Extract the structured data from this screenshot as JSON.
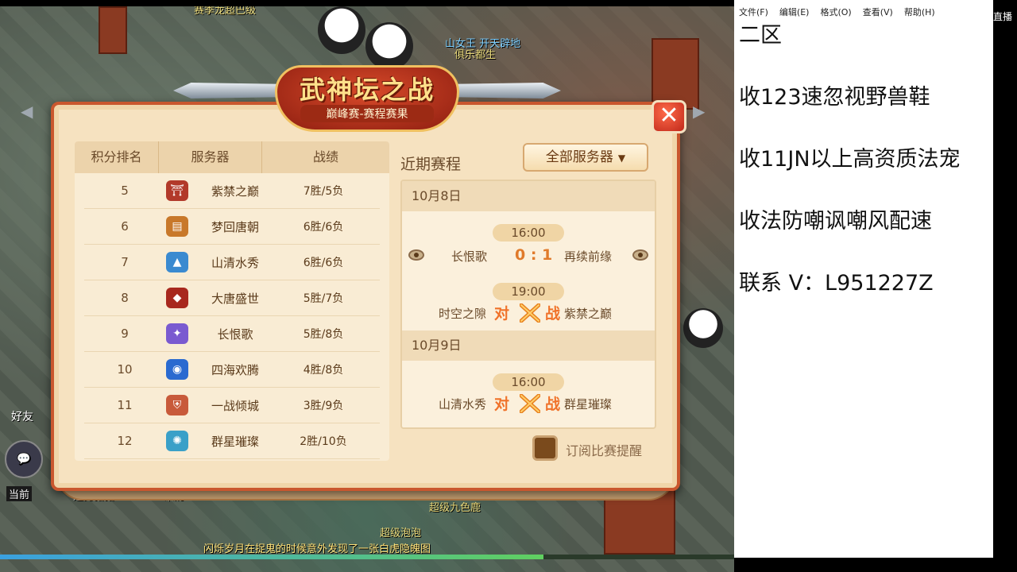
{
  "game": {
    "bg_texts": {
      "top_left": "赛季龙超巴级",
      "guild_line": "山女王  开天辟地",
      "name_tag": "俱乐都生",
      "player_a": "超级九色鹿",
      "player_b": "超级泡泡",
      "friends": "好友",
      "current": "当前",
      "stat_line": "逗男猪猪 69  3456  宋奶"
    },
    "chat_line": "闪烁岁月在捉鬼的时候意外发现了一张白虎隐魄图",
    "progress": 0.74
  },
  "dialog": {
    "title": "武神坛之战",
    "subtitle": "巅峰赛-赛程赛果",
    "close_label": "✕",
    "ranking": {
      "headers": [
        "积分排名",
        "服务器",
        "战绩"
      ],
      "rows": [
        {
          "rank": "5",
          "server": "紫禁之巅",
          "record": "7胜/5负",
          "icon": "palace-icon",
          "color": "#b23a2a"
        },
        {
          "rank": "6",
          "server": "梦回唐朝",
          "record": "6胜/6负",
          "icon": "scroll-icon",
          "color": "#c8782a"
        },
        {
          "rank": "7",
          "server": "山清水秀",
          "record": "6胜/6负",
          "icon": "mountain-icon",
          "color": "#3a8ad0"
        },
        {
          "rank": "8",
          "server": "大唐盛世",
          "record": "5胜/7负",
          "icon": "lantern-icon",
          "color": "#a8281e"
        },
        {
          "rank": "9",
          "server": "长恨歌",
          "record": "5胜/8负",
          "icon": "feather-icon",
          "color": "#7a5ad0"
        },
        {
          "rank": "10",
          "server": "四海欢腾",
          "record": "4胜/8负",
          "icon": "wave-icon",
          "color": "#2a6ad0"
        },
        {
          "rank": "11",
          "server": "一战倾城",
          "record": "3胜/9负",
          "icon": "armor-icon",
          "color": "#c85a3a"
        },
        {
          "rank": "12",
          "server": "群星璀璨",
          "record": "2胜/10负",
          "icon": "star-icon",
          "color": "#3aa0c8"
        }
      ]
    },
    "schedule": {
      "title": "近期赛程",
      "filter_label": "全部服务器",
      "days": [
        {
          "date": "10月8日",
          "matches": [
            {
              "time": "16:00",
              "left": "长恨歌",
              "right": "再续前缘",
              "score": "0 : 1",
              "finished": true
            },
            {
              "time": "19:00",
              "left": "时空之隙",
              "right": "紫禁之巅",
              "dui": "对",
              "zhan": "战",
              "finished": false
            }
          ]
        },
        {
          "date": "10月9日",
          "matches": [
            {
              "time": "16:00",
              "left": "山清水秀",
              "right": "群星璀璨",
              "dui": "对",
              "zhan": "战",
              "finished": false
            }
          ]
        }
      ]
    },
    "subscribe_label": "订阅比赛提醒"
  },
  "notepad": {
    "menu": [
      "文件(F)",
      "编辑(E)",
      "格式(O)",
      "查看(V)",
      "帮助(H)"
    ],
    "lines": [
      "二区",
      "收123速忽视野兽鞋",
      "收11JN以上高资质法宠",
      "收法防嘲讽嘲风配速",
      "联系 V：L951227Z"
    ],
    "stream_tag": "直播"
  }
}
